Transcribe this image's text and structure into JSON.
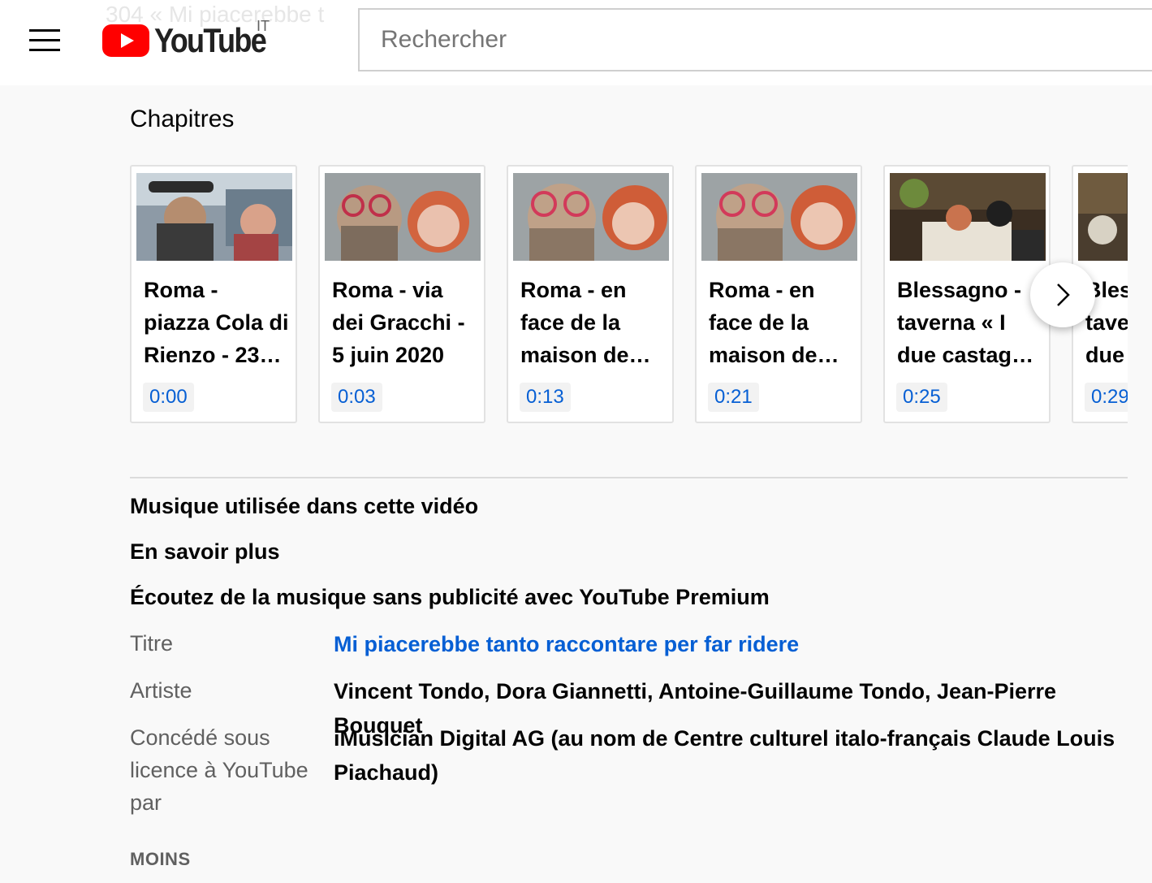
{
  "header": {
    "ghost_title": "304 « Mi piacerebbe t",
    "logo_text": "YouTube",
    "country_code": "IT",
    "search_placeholder": "Rechercher",
    "brand_color": "#ff0000"
  },
  "chapters": {
    "title": "Chapitres",
    "items": [
      {
        "line1": "Roma -",
        "line2": "piazza Cola di",
        "line3": "Rienzo - 23…",
        "time": "0:00"
      },
      {
        "line1": "Roma - via",
        "line2": "dei Gracchi -",
        "line3": "5 juin 2020",
        "time": "0:03"
      },
      {
        "line1": "Roma - en",
        "line2": "face de la",
        "line3": "maison de…",
        "time": "0:13"
      },
      {
        "line1": "Roma - en",
        "line2": "face de la",
        "line3": "maison de…",
        "time": "0:21"
      },
      {
        "line1": "Blessagno -",
        "line2": "taverna « I",
        "line3": "due castagn…",
        "time": "0:25"
      },
      {
        "line1": "Bles",
        "line2": "tave",
        "line3": "due",
        "time": "0:29"
      }
    ],
    "next_icon": "chevron-right-icon"
  },
  "music": {
    "heading": "Musique utilisée dans cette vidéo",
    "learn_more": "En savoir plus",
    "premium": "Écoutez de la musique sans publicité avec YouTube Premium",
    "title_label": "Titre",
    "title_value": "Mi piacerebbe tanto raccontare per far ridere",
    "artist_label": "Artiste",
    "artist_value": "Vincent Tondo, Dora Giannetti, Antoine-Guillaume Tondo, Jean-Pierre Bouquet",
    "license_label": "Concédé sous licence à YouTube par",
    "license_value": "iMusician Digital AG (au nom de Centre culturel italo-français Claude Louis Piachaud)",
    "less": "MOINS"
  }
}
